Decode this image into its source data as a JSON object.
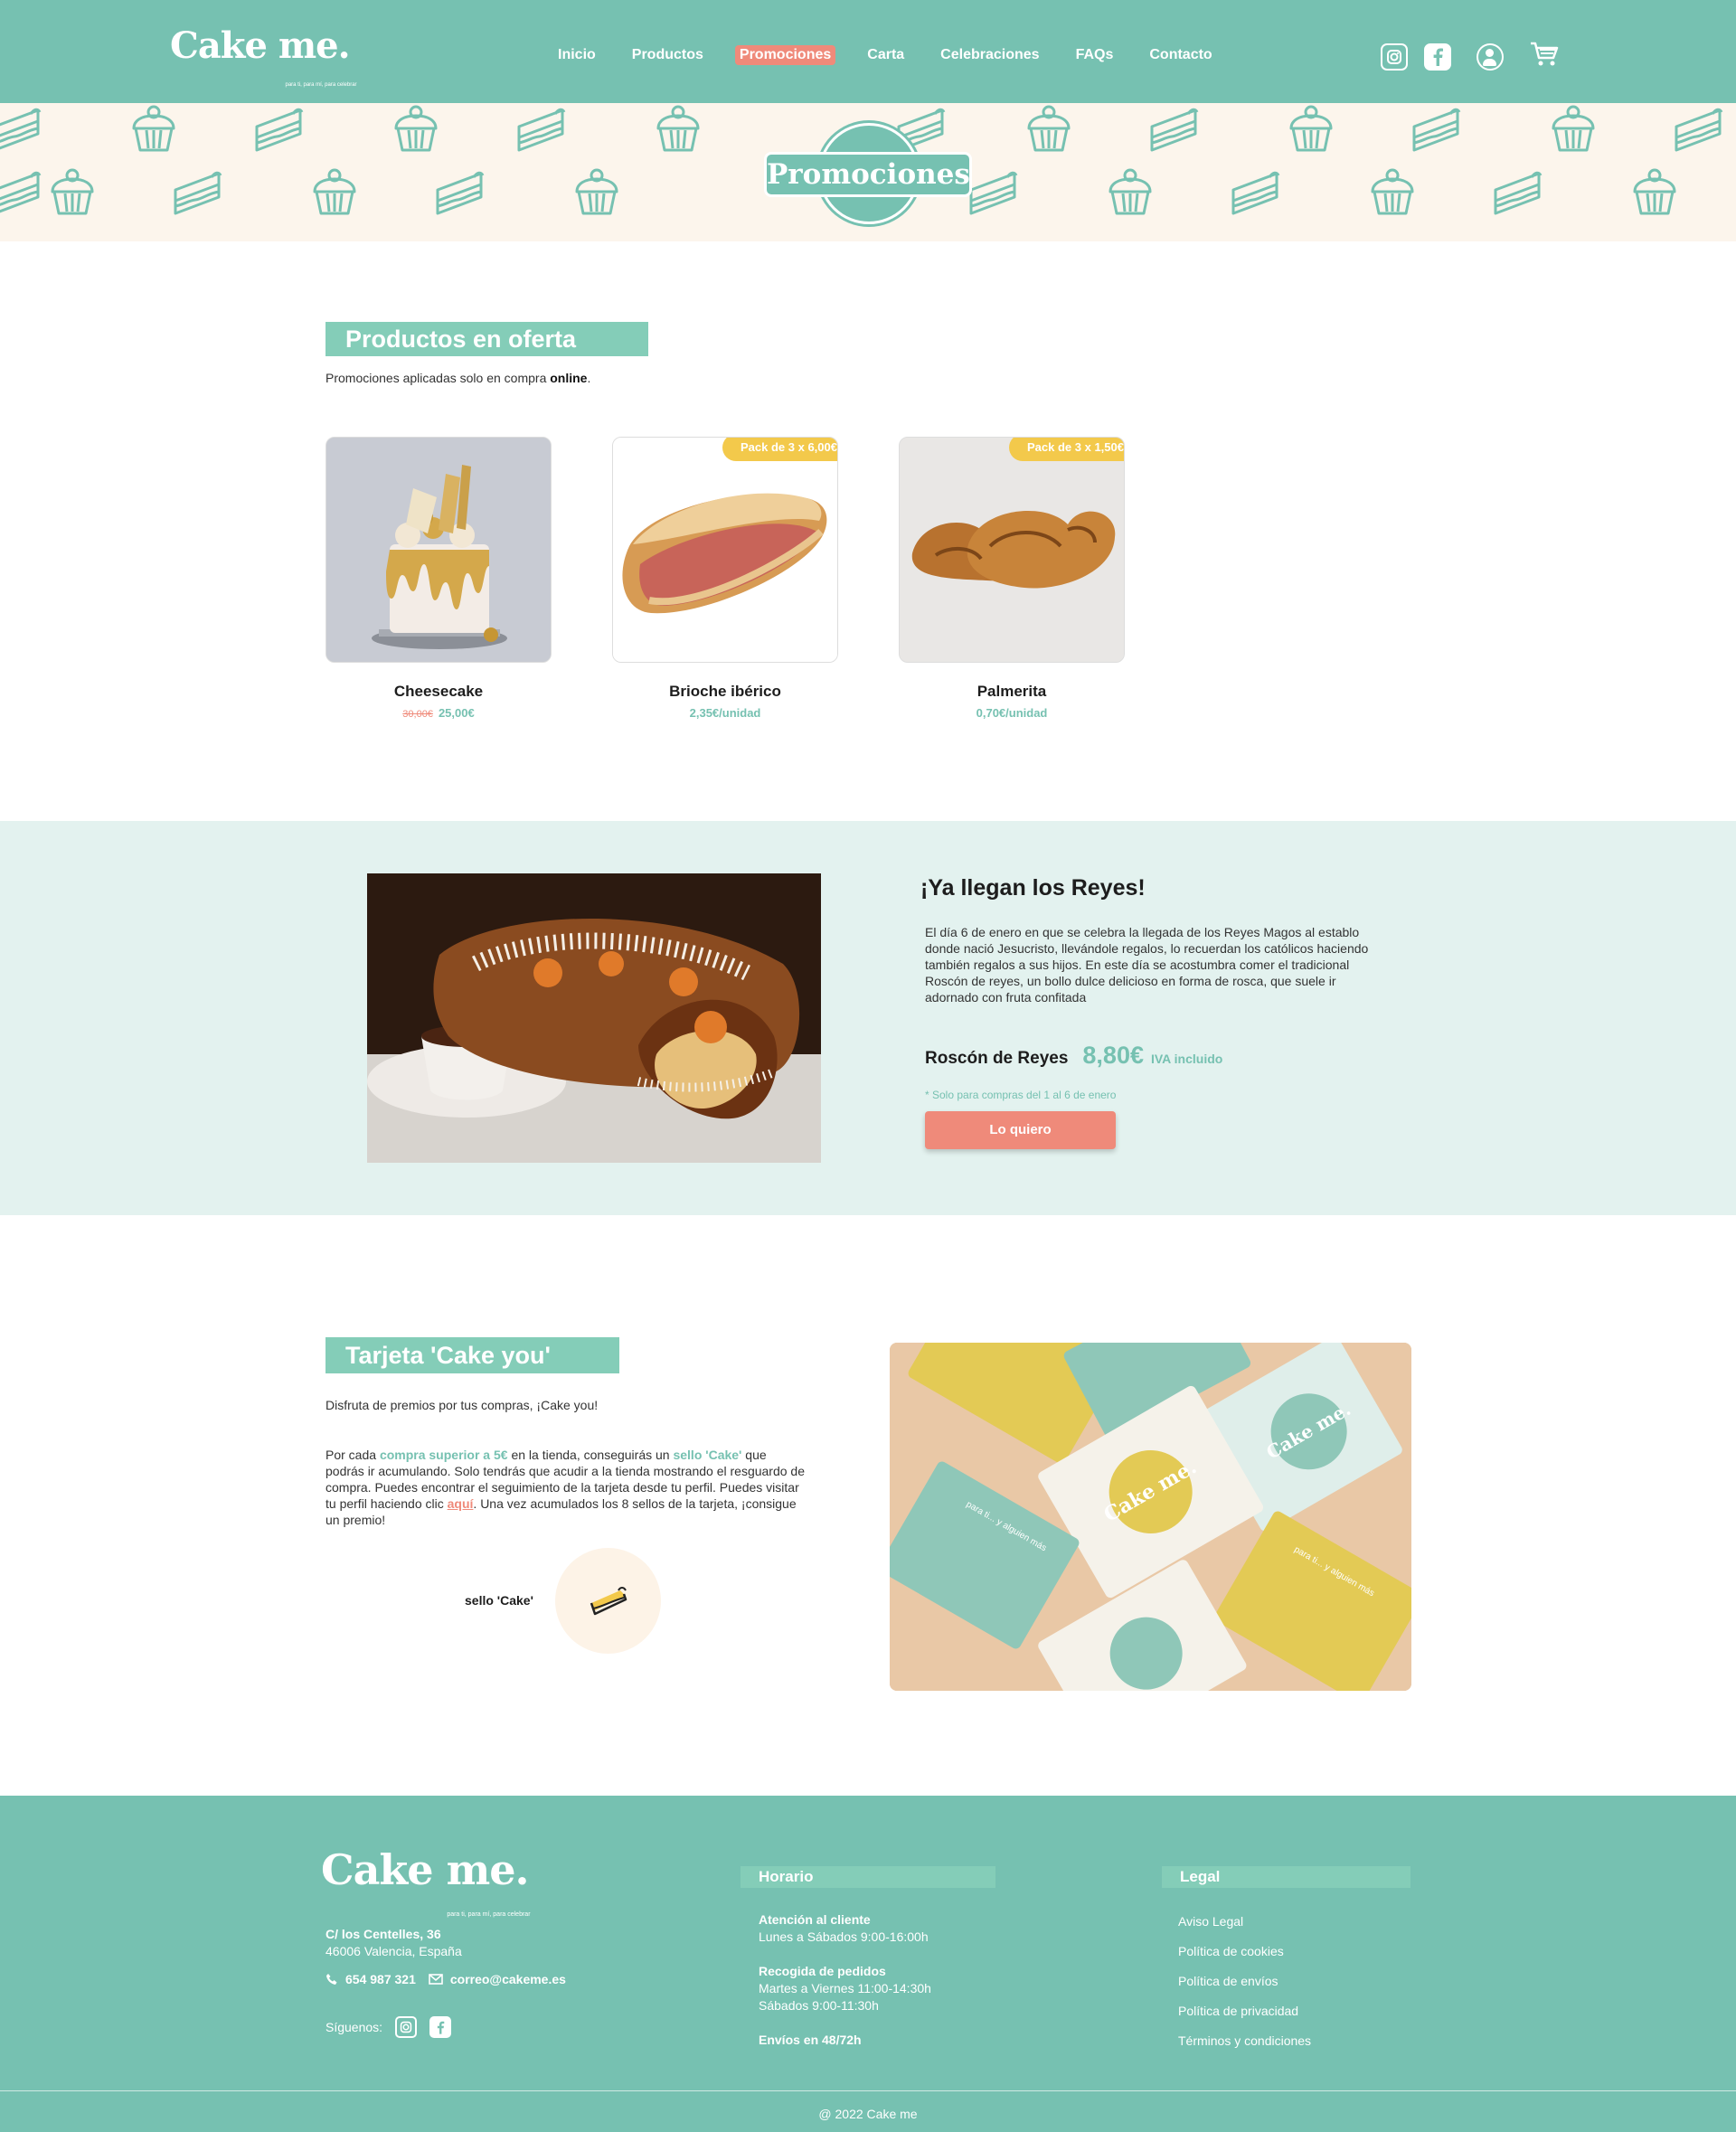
{
  "header": {
    "logo": "Cake me.",
    "logo_tagline": "para ti, para mí, para celebrar",
    "nav": [
      "Inicio",
      "Productos",
      "Promociones",
      "Carta",
      "Celebraciones",
      "FAQs",
      "Contacto"
    ],
    "active_nav": "Promociones",
    "icons": [
      "instagram-icon",
      "facebook-icon",
      "user-icon",
      "cart-icon"
    ]
  },
  "banner": {
    "title": "Promociones"
  },
  "offers": {
    "title": "Productos en oferta",
    "subtitle_prefix": "Promociones aplicadas solo en compra ",
    "subtitle_bold": "online",
    "subtitle_suffix": ".",
    "products": [
      {
        "name": "Cheesecake",
        "old_price": "30,00€",
        "price": "25,00€",
        "pack": ""
      },
      {
        "name": "Brioche ibérico",
        "old_price": "",
        "price": "2,35€/unidad",
        "pack": "Pack de 3 x 6,00€"
      },
      {
        "name": "Palmerita",
        "old_price": "",
        "price": "0,70€/unidad",
        "pack": "Pack de 3 x 1,50€"
      }
    ]
  },
  "reyes": {
    "title": "¡Ya llegan los Reyes!",
    "text": "El día 6 de enero en que se celebra la llegada de los Reyes Magos al establo donde nació Jesucristo, llevándole regalos, lo recuerdan los católicos haciendo también regalos a sus hijos. En este día se acostumbra comer el tradicional Roscón de reyes, un bollo dulce delicioso en forma de rosca, que suele ir adornado con fruta confitada",
    "product": "Roscón de Reyes",
    "price": "8,80€",
    "iva": "IVA incluido",
    "note": "* Solo para compras del 1 al 6 de enero",
    "button": "Lo quiero"
  },
  "tarjeta": {
    "title": "Tarjeta 'Cake you'",
    "intro": "Disfruta de premios por tus compras, ¡Cake you!",
    "p_a": "Por cada ",
    "p_b": "compra superior a 5€",
    "p_c": " en la tienda, conseguirás un ",
    "p_d": "sello 'Cake'",
    "p_e": " que podrás ir acumulando. Solo tendrás que acudir a la tienda mostrando el resguardo de compra. Puedes encontrar el seguimiento de la tarjeta desde tu perfil. Puedes visitar tu perfil haciendo clic ",
    "p_f": "aquí",
    "p_g": ". Una vez acumulados los 8 sellos de la tarjeta, ¡consigue un premio!",
    "sello_label": "sello 'Cake'",
    "card_text_1": "Cake me.",
    "card_text_2": "para ti... y alguien más"
  },
  "footer": {
    "logo": "Cake me.",
    "logo_tagline": "para ti, para mí, para celebrar",
    "street": "C/ los Centelles, 36",
    "city": "46006 Valencia, España",
    "phone": "654 987 321",
    "email": "correo@cakeme.es",
    "follow": "Síguenos:",
    "horario_title": "Horario",
    "atencion_title": "Atención al cliente",
    "atencion_text": "Lunes a Sábados 9:00-16:00h",
    "recogida_title": "Recogida de pedidos",
    "recogida_1": "Martes a Viernes 11:00-14:30h",
    "recogida_2": "Sábados 9:00-11:30h",
    "envios": "Envíos en 48/72h",
    "legal_title": "Legal",
    "legal_links": [
      "Aviso Legal",
      "Política de cookies",
      "Política de envíos",
      "Política de privacidad",
      "Términos y condiciones"
    ],
    "copyright": "@ 2022 Cake me"
  },
  "colors": {
    "teal": "#76c1b1",
    "mint": "#84cdb8",
    "coral": "#ef8a7a",
    "yellow": "#f3c94b",
    "cream": "#fcf5ec"
  }
}
